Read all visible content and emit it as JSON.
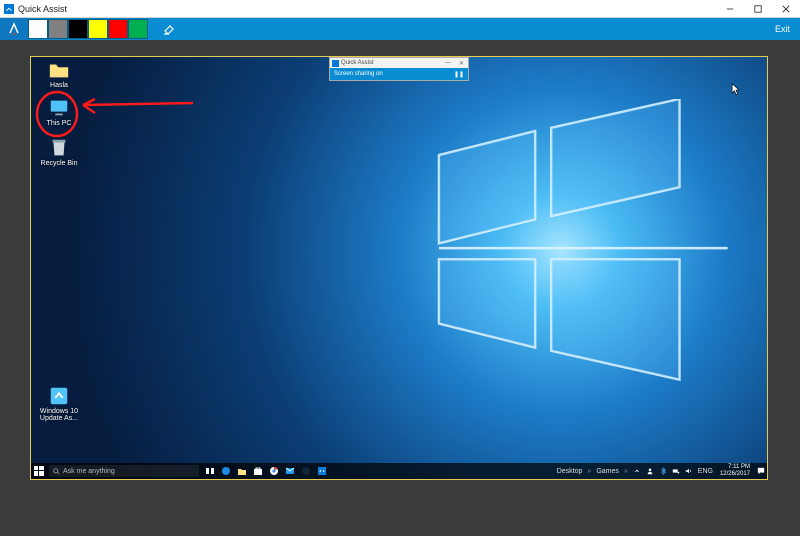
{
  "window": {
    "title": "Quick Assist",
    "exit_label": "Exit",
    "colors": {
      "white": "#ffffff",
      "gray": "#808080",
      "black": "#000000",
      "yellow": "#ffff00",
      "red": "#ff0000",
      "green": "#00b050"
    }
  },
  "remote": {
    "qa_mini": {
      "title": "Quick Assist",
      "status": "Screen sharing on",
      "pause_glyph": "❚❚"
    },
    "icons": {
      "hasla": "Hasla",
      "this_pc": "This PC",
      "recycle_bin": "Recycle Bin",
      "win_update": "Windows 10 Update As..."
    },
    "taskbar": {
      "search_placeholder": "Ask me anything",
      "toolbars": {
        "desktop": "Desktop",
        "games": "Games"
      },
      "lang": "ENG",
      "clock": {
        "time": "7:11 PM",
        "date": "12/26/2017"
      }
    }
  }
}
